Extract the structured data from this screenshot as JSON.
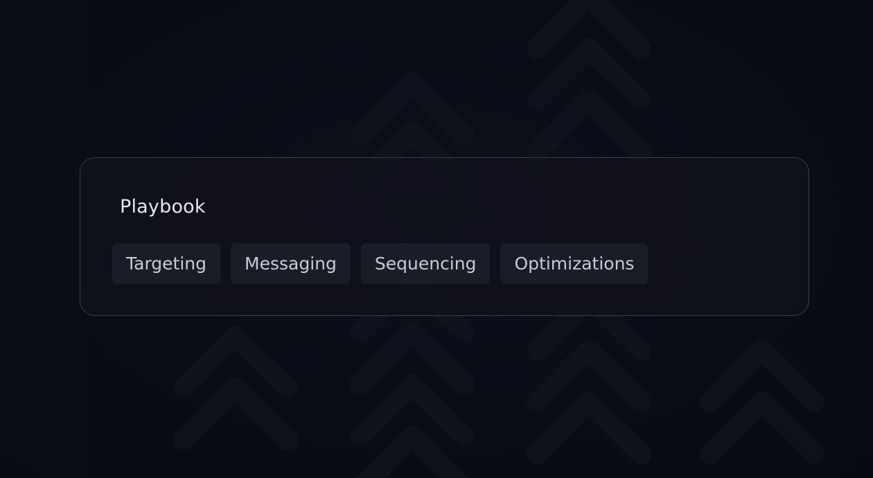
{
  "playbook": {
    "title": "Playbook",
    "chips": [
      {
        "label": "Targeting"
      },
      {
        "label": "Messaging"
      },
      {
        "label": "Sequencing"
      },
      {
        "label": "Optimizations"
      }
    ]
  },
  "colors": {
    "background": "#0a0c16",
    "card_border": "#3a3d4a",
    "chip_background": "#1a1c27",
    "title_text": "#e6e7ec",
    "chip_text": "#c9cbd4"
  }
}
